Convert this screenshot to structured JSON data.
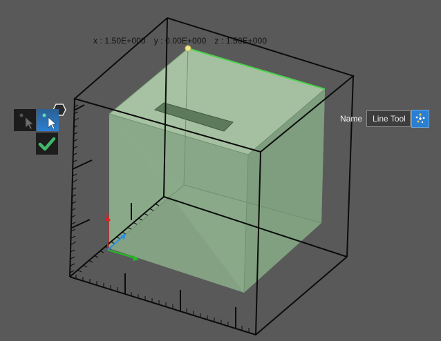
{
  "coordinates": {
    "x_label": "x : ",
    "x_value": "1.50E+000",
    "y_label": "y : ",
    "y_value": "0.00E+000",
    "z_label": "z : ",
    "z_value": "1.50E+000"
  },
  "toolbar": {
    "select_mode_left_icon": "pointer-dot-icon",
    "select_mode_right_icon": "pointer-dot-icon",
    "confirm_icon": "checkmark-icon",
    "handle_icon": "hexagon-icon"
  },
  "name_field": {
    "label": "Name",
    "value": "Line Tool",
    "settings_icon": "sparkle-settings-icon"
  },
  "colors": {
    "background": "#595959",
    "box_fill": "#8fb48f",
    "edge_highlight": "#4cd24c",
    "accent_blue": "#2b7fd3",
    "axis_x": "#e02020",
    "axis_y": "#20c020",
    "axis_z": "#2a8fe0",
    "checkmark": "#3fb86a"
  }
}
